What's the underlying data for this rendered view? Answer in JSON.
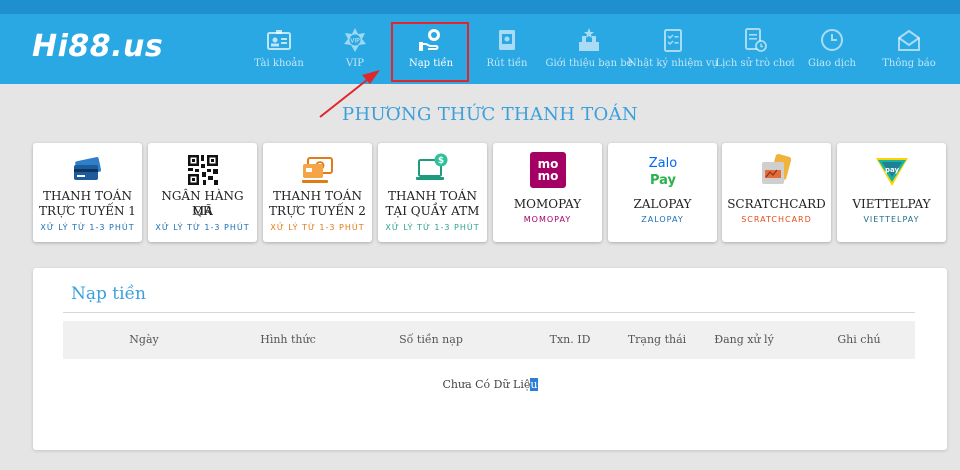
{
  "header": {
    "logo": "Hi88.us",
    "nav": [
      {
        "label": "Tài khoản",
        "icon": "id-card-icon",
        "active": false
      },
      {
        "label": "VIP",
        "icon": "vip-badge-icon",
        "active": false
      },
      {
        "label": "Nạp tiền",
        "icon": "deposit-hand-coin-icon",
        "active": true
      },
      {
        "label": "Rút tiền",
        "icon": "withdraw-safe-icon",
        "active": false
      },
      {
        "label": "Giới thiệu bạn bè",
        "icon": "refer-friend-icon",
        "active": false
      },
      {
        "label": "Nhật ký nhiệm vụ",
        "icon": "task-checklist-icon",
        "active": false
      },
      {
        "label": "Lịch sử trò chơi",
        "icon": "game-history-icon",
        "active": false
      },
      {
        "label": "Giao dịch",
        "icon": "transaction-clock-icon",
        "active": false
      },
      {
        "label": "Thông báo",
        "icon": "notification-envelope-icon",
        "active": false
      }
    ]
  },
  "page_title": "PHƯƠNG THỨC THANH TOÁN",
  "methods": [
    {
      "name_line1": "THANH TOÁN",
      "name_line2": "TRỰC TUYẾN 1",
      "sub": "XỬ LÝ TỪ 1-3 PHÚT",
      "sub_color": "#1a6fb3",
      "icon": "credit-cards-icon"
    },
    {
      "name_line1": "NGÂN HÀNG MÃ",
      "name_line2": "QR",
      "sub": "XỬ LÝ TỪ 1-3 PHÚT",
      "sub_color": "#1a6fb3",
      "icon": "qr-code-icon"
    },
    {
      "name_line1": "THANH TOÁN",
      "name_line2": "TRỰC TUYẾN 2",
      "sub": "XỬ LÝ TỪ 1-3 PHÚT",
      "sub_color": "#e07b16",
      "icon": "cash-card-icon"
    },
    {
      "name_line1": "THANH TOÁN",
      "name_line2": "TẠI QUẦY ATM",
      "sub": "XỬ LÝ TỪ 1-3 PHÚT",
      "sub_color": "#2aa58a",
      "icon": "atm-laptop-icon"
    },
    {
      "name_line1": "MOMOPAY",
      "name_line2": "",
      "sub": "MOMOPAY",
      "sub_color": "#a50064",
      "icon": "momo-logo-icon"
    },
    {
      "name_line1": "ZALOPAY",
      "name_line2": "",
      "sub": "ZALOPAY",
      "sub_color": "#1a6fb3",
      "icon": "zalopay-logo-icon"
    },
    {
      "name_line1": "SCRATCHCARD",
      "name_line2": "",
      "sub": "SCRATCHCARD",
      "sub_color": "#e0501a",
      "icon": "scratchcard-icon"
    },
    {
      "name_line1": "VIETTELPAY",
      "name_line2": "",
      "sub": "VIETTELPAY",
      "sub_color": "#1f6f8b",
      "icon": "viettelpay-logo-icon"
    }
  ],
  "deposit": {
    "title": "Nạp tiền",
    "columns": [
      "Ngày",
      "Hình thức",
      "Số tiền nạp",
      "Txn. ID",
      "Trạng thái",
      "Đang xử lý",
      "Ghi chú"
    ],
    "empty_text_before": "Chưa Có Dữ Liệ",
    "empty_text_selected": "u"
  },
  "colors": {
    "header_bg": "#2aa8e3",
    "accent": "#3aa0dc",
    "highlight_red": "#e0252b"
  },
  "logo_texts": {
    "momo": "mo mo",
    "zalo": "Zalo",
    "pay": "Pay",
    "viettel": "pay"
  }
}
